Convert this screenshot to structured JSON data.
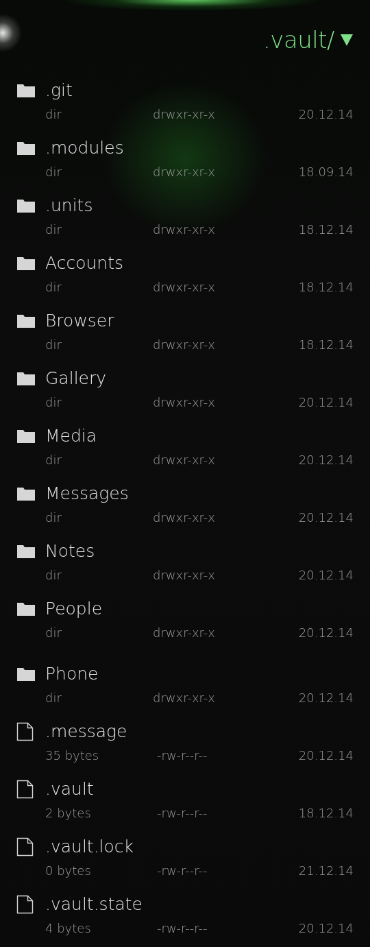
{
  "header": {
    "title": ".vault/"
  },
  "entries": [
    {
      "kind": "dir",
      "name": ".git",
      "size": "dir",
      "permissions": "drwxr-xr-x",
      "modified": "20.12.14"
    },
    {
      "kind": "dir",
      "name": ".modules",
      "size": "dir",
      "permissions": "drwxr-xr-x",
      "modified": "18.09.14"
    },
    {
      "kind": "dir",
      "name": ".units",
      "size": "dir",
      "permissions": "drwxr-xr-x",
      "modified": "18.12.14"
    },
    {
      "kind": "dir",
      "name": "Accounts",
      "size": "dir",
      "permissions": "drwxr-xr-x",
      "modified": "18.12.14"
    },
    {
      "kind": "dir",
      "name": "Browser",
      "size": "dir",
      "permissions": "drwxr-xr-x",
      "modified": "18.12.14"
    },
    {
      "kind": "dir",
      "name": "Gallery",
      "size": "dir",
      "permissions": "drwxr-xr-x",
      "modified": "20.12.14"
    },
    {
      "kind": "dir",
      "name": "Media",
      "size": "dir",
      "permissions": "drwxr-xr-x",
      "modified": "20.12.14"
    },
    {
      "kind": "dir",
      "name": "Messages",
      "size": "dir",
      "permissions": "drwxr-xr-x",
      "modified": "20.12.14"
    },
    {
      "kind": "dir",
      "name": "Notes",
      "size": "dir",
      "permissions": "drwxr-xr-x",
      "modified": "20.12.14"
    },
    {
      "kind": "dir",
      "name": "People",
      "size": "dir",
      "permissions": "drwxr-xr-x",
      "modified": "20.12.14"
    },
    {
      "kind": "dir",
      "name": "Phone",
      "size": "dir",
      "permissions": "drwxr-xr-x",
      "modified": "20.12.14"
    },
    {
      "kind": "file",
      "name": ".message",
      "size": "35 bytes",
      "permissions": "-rw-r--r--",
      "modified": "20.12.14"
    },
    {
      "kind": "file",
      "name": ".vault",
      "size": "2 bytes",
      "permissions": "-rw-r--r--",
      "modified": "18.12.14"
    },
    {
      "kind": "file",
      "name": ".vault.lock",
      "size": "0 bytes",
      "permissions": "-rw-r--r--",
      "modified": "21.12.14"
    },
    {
      "kind": "file",
      "name": ".vault.state",
      "size": "4 bytes",
      "permissions": "-rw-r--r--",
      "modified": "20.12.14"
    }
  ]
}
